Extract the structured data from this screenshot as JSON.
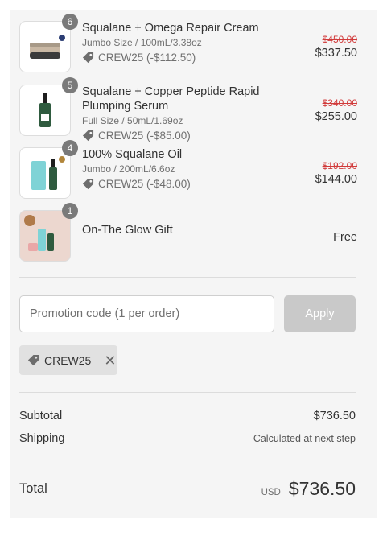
{
  "items": [
    {
      "quantity": "6",
      "name": "Squalane + Omega Repair Cream",
      "variant": "Jumbo Size / 100mL/3.38oz",
      "discount": "CREW25 (-$112.50)",
      "original_price": "$450.00",
      "price": "$337.50"
    },
    {
      "quantity": "5",
      "name": "Squalane + Copper Peptide Rapid Plumping Serum",
      "variant": "Full Size / 50mL/1.69oz",
      "discount": "CREW25 (-$85.00)",
      "original_price": "$340.00",
      "price": "$255.00"
    },
    {
      "quantity": "4",
      "name": "100% Squalane Oil",
      "variant": "Jumbo / 200mL/6.6oz",
      "discount": "CREW25 (-$48.00)",
      "original_price": "$192.00",
      "price": "$144.00"
    },
    {
      "quantity": "1",
      "name": "On-The Glow Gift",
      "price": "Free"
    }
  ],
  "promo": {
    "placeholder": "Promotion code (1 per order)",
    "apply_label": "Apply",
    "applied_code": "CREW25"
  },
  "totals": {
    "subtotal_label": "Subtotal",
    "subtotal_value": "$736.50",
    "shipping_label": "Shipping",
    "shipping_value": "Calculated at next step",
    "total_label": "Total",
    "currency": "USD",
    "total_value": "$736.50"
  },
  "colors": {
    "panel_bg": "#f5f5f5",
    "strike_price": "#d13a3a",
    "apply_disabled": "#c9c9c9",
    "qty_badge": "#7a7a7a"
  },
  "icons": {
    "discount": "tag-icon",
    "remove": "close-icon"
  }
}
